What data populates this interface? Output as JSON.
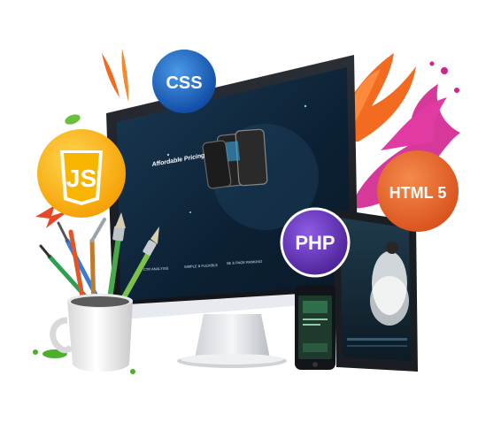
{
  "badges": {
    "css": "CSS",
    "js": "JS",
    "html": "HTML 5",
    "php": "PHP"
  },
  "monitor_screen": {
    "headline": "Affordable Pricing",
    "features": [
      "CTR ANALYSIS",
      "SIMPLE & FLEXIBLE",
      "SE & PAGE RANKING"
    ]
  },
  "colors": {
    "css_badge": "#1565c0",
    "js_badge": "#f4b400",
    "html_badge": "#e8622c",
    "php_badge": "#5a2ea6",
    "screen_bg": "#0e2236",
    "splash_pink": "#d1238f",
    "splash_orange": "#f26b21"
  }
}
